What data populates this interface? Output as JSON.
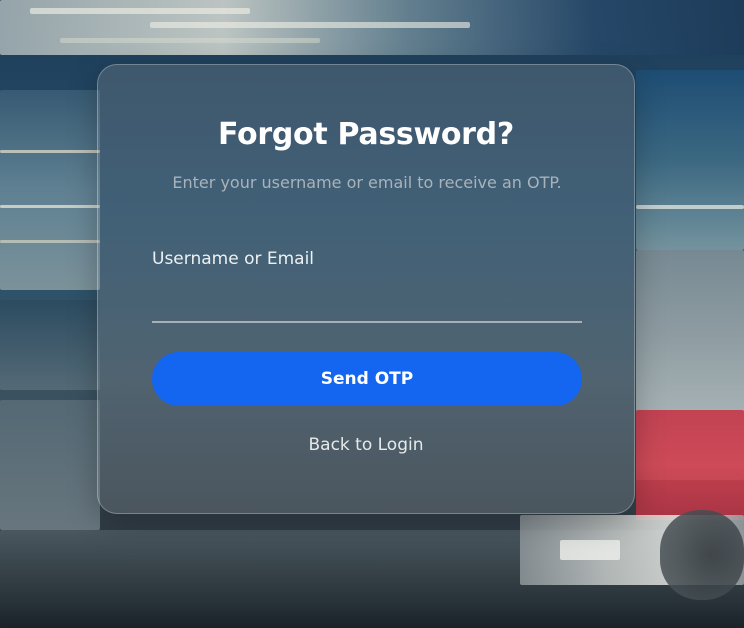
{
  "form": {
    "title": "Forgot Password?",
    "subtitle": "Enter your username or email to receive an OTP.",
    "username_label": "Username or Email",
    "username_value": "",
    "username_placeholder": "",
    "submit_label": "Send OTP",
    "back_link_label": "Back to Login"
  },
  "colors": {
    "button": "#1465ef",
    "text_primary": "#ffffff",
    "text_muted": "#a9b3ba"
  }
}
